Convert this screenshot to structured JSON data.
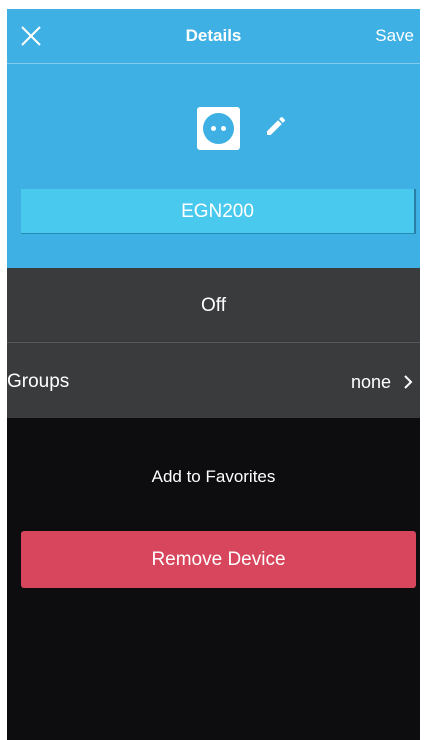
{
  "header": {
    "title": "Details",
    "save_label": "Save",
    "close_icon": "close-icon"
  },
  "device": {
    "icon": "power-socket-icon",
    "edit_icon": "pencil-icon",
    "name": "EGN200"
  },
  "rows": {
    "state_label": "Off",
    "groups_label": "Groups",
    "groups_value": "none"
  },
  "actions": {
    "favorites_label": "Add to Favorites",
    "remove_label": "Remove Device"
  },
  "colors": {
    "header_blue": "#3fb0e3",
    "field_blue": "#4ac9ee",
    "row_gray": "#3a3b3d",
    "danger": "#d8465d",
    "background": "#0d0d0f"
  }
}
